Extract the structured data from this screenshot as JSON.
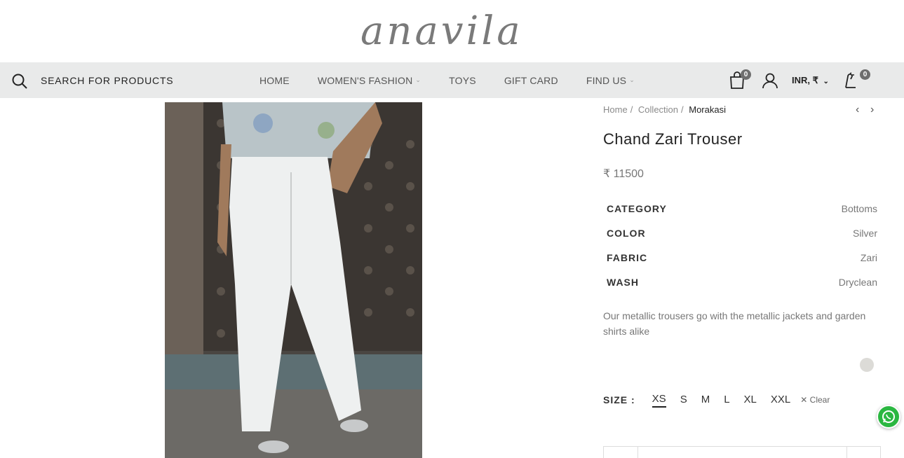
{
  "brand": {
    "logo_text": "anavila"
  },
  "nav": {
    "search_label": "SEARCH FOR PRODUCTS",
    "menu": [
      {
        "label": "HOME",
        "has_dropdown": false
      },
      {
        "label": "WOMEN'S FASHION",
        "has_dropdown": true
      },
      {
        "label": "TOYS",
        "has_dropdown": false
      },
      {
        "label": "GIFT CARD",
        "has_dropdown": false
      },
      {
        "label": "FIND US",
        "has_dropdown": true
      }
    ],
    "cart_count": "0",
    "currency": "INR, ₹",
    "wishlist_count": "0"
  },
  "breadcrumb": {
    "items": [
      "Home",
      "Collection"
    ],
    "current": "Morakasi"
  },
  "product": {
    "title": "Chand Zari Trouser",
    "price": "₹ 11500",
    "attributes": [
      {
        "label": "CATEGORY",
        "value": "Bottoms"
      },
      {
        "label": "COLOR",
        "value": "Silver"
      },
      {
        "label": "FABRIC",
        "value": "Zari"
      },
      {
        "label": "WASH",
        "value": "Dryclean"
      }
    ],
    "description": "Our metallic trousers go with the metallic jackets and garden shirts alike",
    "swatch_color": "#dcdbd7",
    "size_label": "SIZE :",
    "sizes": [
      "XS",
      "S",
      "M",
      "L",
      "XL",
      "XXL"
    ],
    "selected_size": "XS",
    "clear_label": "Clear"
  },
  "colors": {
    "nav_bg": "#e9eaea",
    "whatsapp": "#2bb741"
  }
}
